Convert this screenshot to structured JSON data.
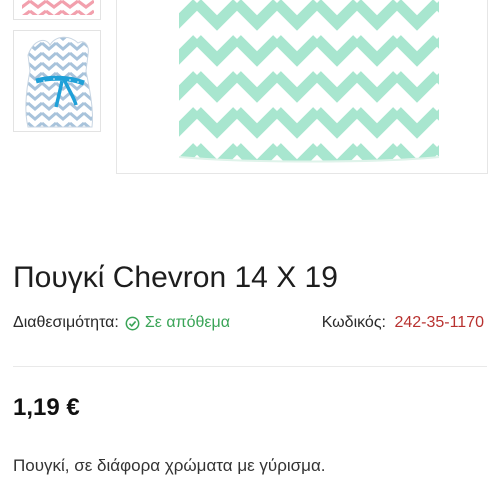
{
  "gallery": {
    "thumbnails": [
      {
        "icon": "pink-chevron-pouch-thumbnail",
        "color": "#f2a0ad"
      },
      {
        "icon": "blue-chevron-pouch-thumbnail",
        "color": "#a8c3db",
        "ribbon_color": "#1fa0d8"
      }
    ],
    "scroll_icon": "chevron-down-icon",
    "main_image": {
      "icon": "mint-chevron-pouch-image",
      "color": "#a8e6cf"
    }
  },
  "product": {
    "title": "Πουγκί Chevron 14 X 19",
    "availability_label": "Διαθεσιμότητα:",
    "availability_value": "Σε απόθεμα",
    "availability_icon": "check-circle-icon",
    "code_label": "Κωδικός:",
    "code_value": "242-35-1170",
    "price": "1,19 €",
    "description": "Πουγκί, σε διάφορα χρώματα με γύρισμα."
  },
  "colors": {
    "in_stock": "#3aa457",
    "code_value": "#b8312f"
  }
}
